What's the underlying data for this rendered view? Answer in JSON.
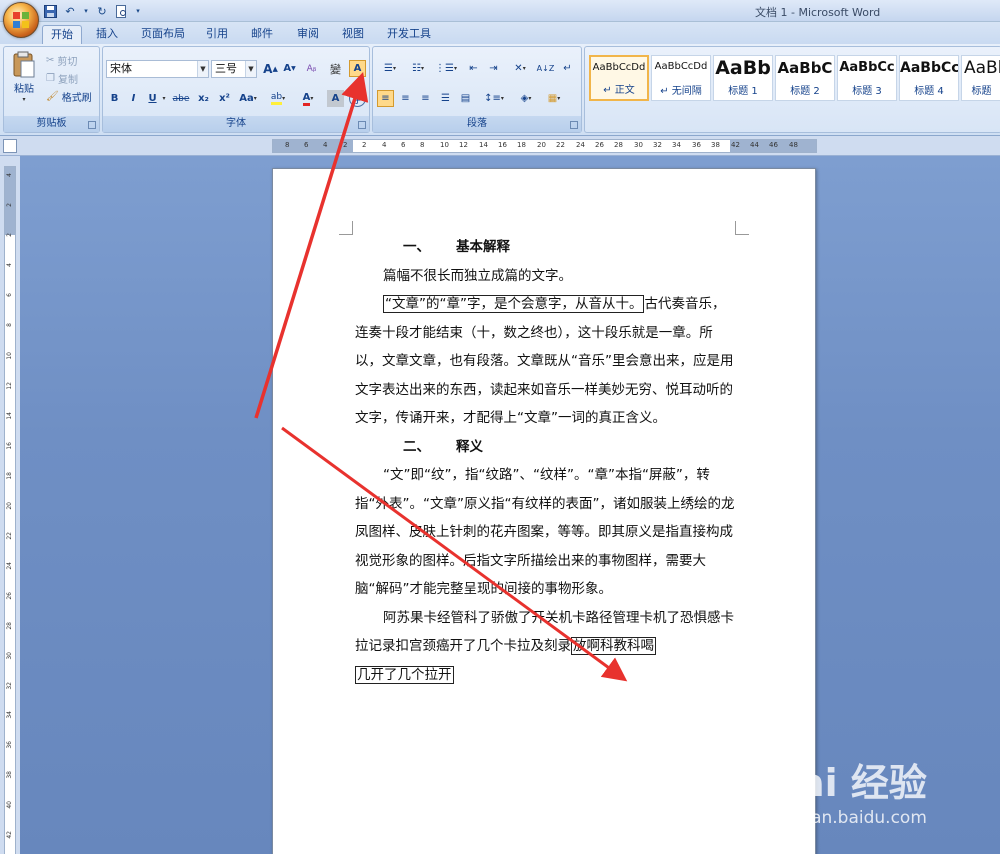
{
  "window": {
    "title": "文档 1 - Microsoft Word"
  },
  "tabs": [
    "开始",
    "插入",
    "页面布局",
    "引用",
    "邮件",
    "审阅",
    "视图",
    "开发工具"
  ],
  "clipboard": {
    "paste": "粘贴",
    "cut": "剪切",
    "copy": "复制",
    "format_painter": "格式刷",
    "label": "剪贴板"
  },
  "font": {
    "name": "宋体",
    "size": "三号",
    "label": "字体",
    "grow": "A",
    "shrink": "A",
    "bold": "B",
    "italic": "I",
    "underline": "U",
    "strike": "abe",
    "subscript": "x₂",
    "superscript": "x²",
    "change_case": "Aa",
    "highlight": "ab",
    "font_color": "A",
    "char_shading": "A",
    "phonetic": "變",
    "char_border": "A",
    "enclose": "字"
  },
  "paragraph": {
    "label": "段落"
  },
  "styles": [
    {
      "sample": "AaBbCcDd",
      "name": "↵ 正文",
      "selected": true
    },
    {
      "sample": "AaBbCcDd",
      "name": "↵ 无间隔"
    },
    {
      "sample": "AaBb",
      "name": "标题 1"
    },
    {
      "sample": "AaBbC",
      "name": "标题 2"
    },
    {
      "sample": "AaBbCc",
      "name": "标题 3"
    },
    {
      "sample": "AaBbCc",
      "name": "标题 4"
    },
    {
      "sample": "AaBb",
      "name": "标题"
    }
  ],
  "ruler": {
    "h_labels": [
      "8",
      "6",
      "4",
      "2",
      "2",
      "4",
      "6",
      "8",
      "10",
      "12",
      "14",
      "16",
      "18",
      "20",
      "22",
      "24",
      "26",
      "28",
      "30",
      "32",
      "34",
      "36",
      "38",
      "42",
      "44",
      "46",
      "48"
    ],
    "v_labels": [
      "4",
      "2",
      "2",
      "4",
      "6",
      "8",
      "10",
      "12",
      "14",
      "16",
      "18",
      "20",
      "22",
      "24",
      "26",
      "28",
      "30",
      "32",
      "34",
      "36",
      "38",
      "40",
      "42"
    ]
  },
  "document": {
    "h1": {
      "num": "一、",
      "text": "基本解释"
    },
    "p1": "篇幅不很长而独立成篇的文字。",
    "p2_boxed": "“文章”的“章”字，是个会意字，从音从十。",
    "p2_rest": "古代奏音乐，连奏十段才能结束（十，数之终也），这十段乐就是一章。所以，文章文章，也有段落。文章既从“音乐”里会意出来，应是用文字表达出来的东西，读起来如音乐一样美妙无穷、悦耳动听的文字，传诵开来，才配得上“文章”一词的真正含义。",
    "h2": {
      "num": "二、",
      "text": "释义"
    },
    "p3": "“文”即“纹”，指“纹路”、“纹样”。“章”本指“屏蔽”，转指“外表”。“文章”原义指“有纹样的表面”，诸如服装上绣绘的龙凤图样、皮肤上针刺的花卉图案，等等。即其原义是指直接构成视觉形象的图样。后指文字所描绘出来的事物图样，需要大脑“解码”才能完整呈现的间接的事物形象。",
    "p4_plain": "阿苏果卡经管科了骄傲了开关机卡路径管理卡机了恐惧感卡拉记录扣宫颈癌开了几个卡拉及刻录",
    "p4_boxed1": "放啊科教科喝",
    "p4_boxed2": "几开了几个拉开"
  },
  "watermark": {
    "text": "Bai 经验",
    "sub": "jingyan.baidu.com"
  },
  "colors": {
    "arrow": "#e8322e",
    "ribbon": "#dbe7f7",
    "workspace": "#6f8fc4"
  }
}
